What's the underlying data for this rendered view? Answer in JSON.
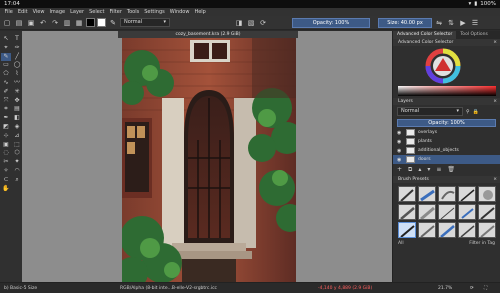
{
  "statusbar": {
    "time": "17:04",
    "battery": "100%"
  },
  "menu": [
    "File",
    "Edit",
    "View",
    "Image",
    "Layer",
    "Select",
    "Filter",
    "Tools",
    "Settings",
    "Window",
    "Help"
  ],
  "toolbar": {
    "blend_mode": "Normal",
    "opacity_label": "Opacity: 100%",
    "size_label": "Size: 40.00 px",
    "fg_color": "#000000",
    "bg_color": "#ffffff"
  },
  "document": {
    "tab_title": "cozy_basement.kra (2.9 GiB)"
  },
  "docker": {
    "tabs": [
      "Advanced Color Selector",
      "Tool Options"
    ],
    "color_title": "Advanced Color Selector",
    "layers_title": "Layers",
    "layer_blend": "Normal",
    "layer_opacity": "Opacity: 100%",
    "layers": [
      {
        "name": "overlays",
        "selected": false
      },
      {
        "name": "plants",
        "selected": false
      },
      {
        "name": "additional_objects",
        "selected": false
      },
      {
        "name": "doors",
        "selected": true
      }
    ],
    "brush_title": "Brush Presets",
    "brush_tag": "All",
    "brush_filter": "Filter in Tag"
  },
  "statusbar_bottom": {
    "brush": "b) Basic-5 Size",
    "color_info": "RGB/Alpha (8-bit inte...B-elle-V2-srgbtrc.icc",
    "coords": "-4,140 y 4,889 (2.9 GiB)",
    "zoom": "21.7%"
  },
  "colors": {
    "accent": "#3d5a86"
  }
}
